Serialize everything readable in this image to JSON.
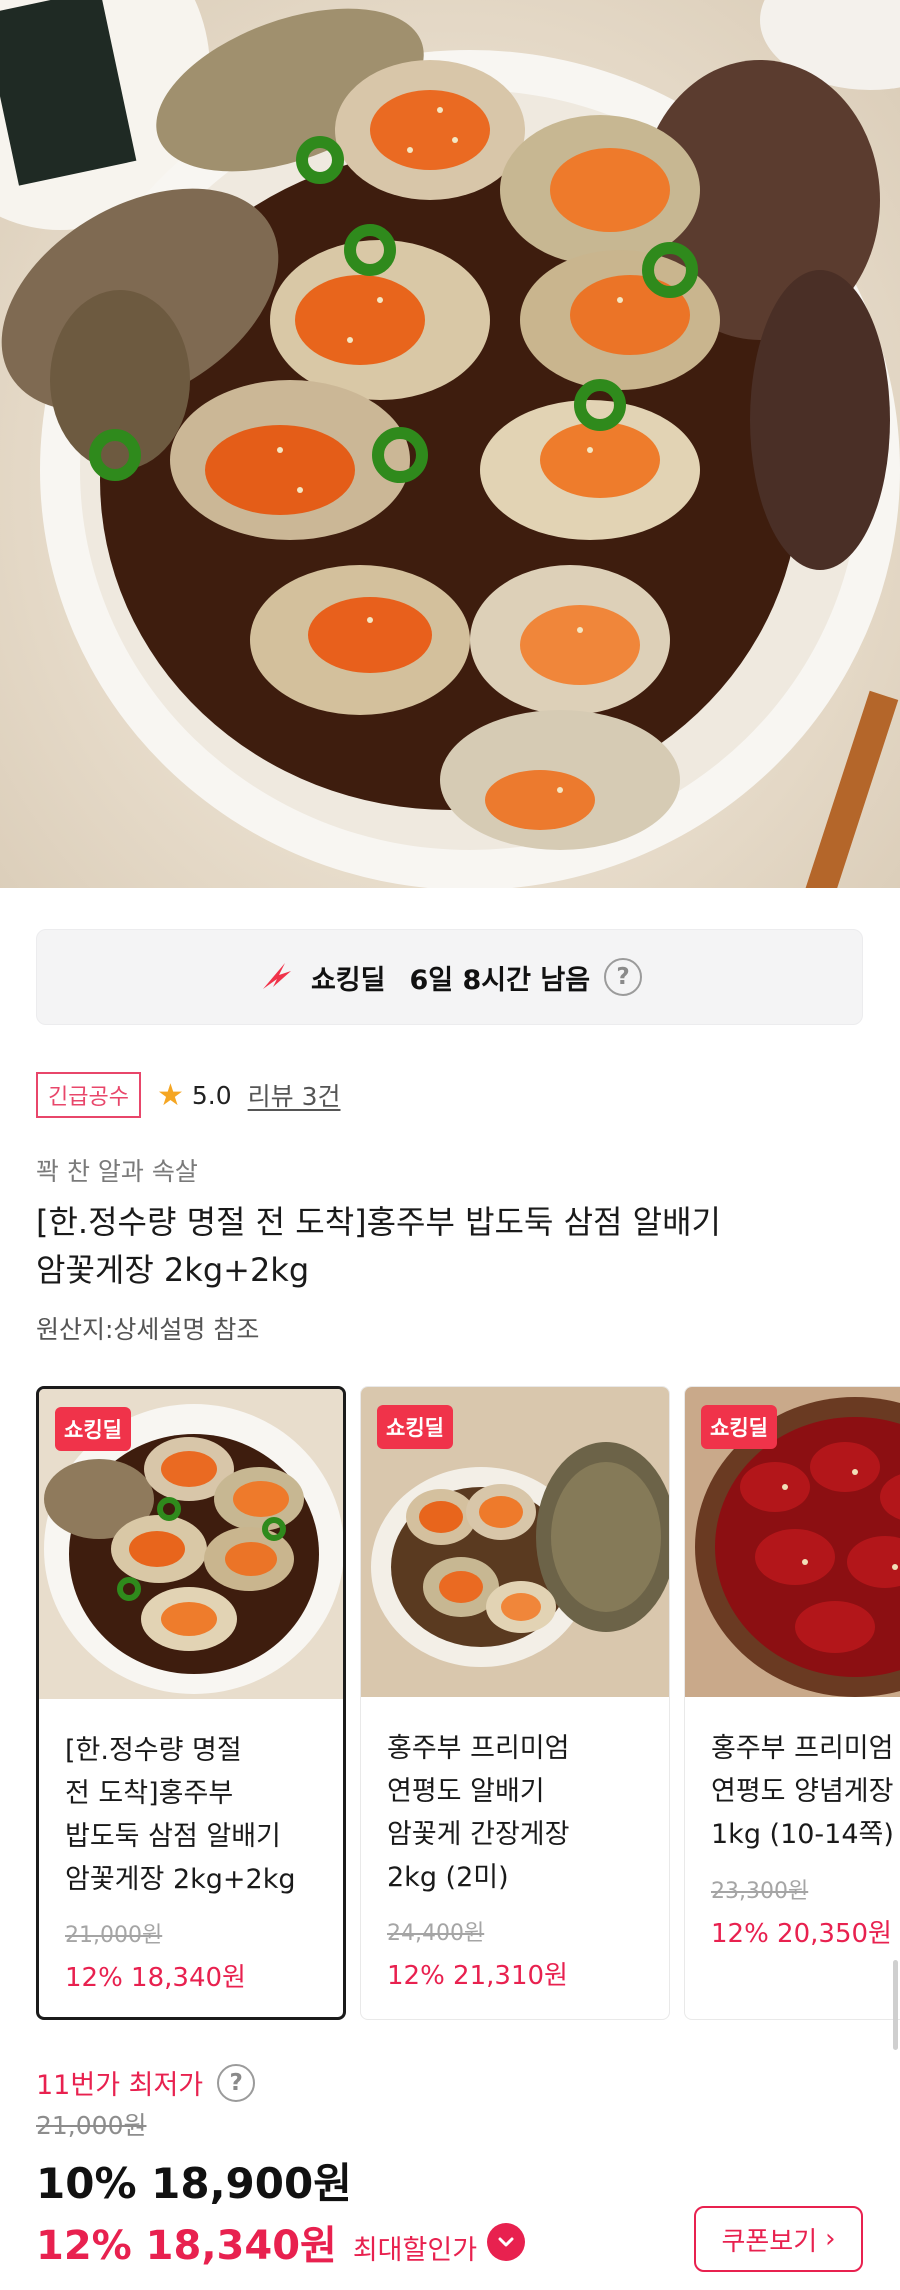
{
  "hero": {
    "image_icon": "marinated-crab-photo"
  },
  "deal_banner": {
    "label": "쇼킹딜",
    "time_left": "6일 8시간 남음",
    "help": "?"
  },
  "badges": {
    "urgent": "긴급공수",
    "rating": "5.0",
    "review": "리뷰 3건"
  },
  "product": {
    "subtitle": "꽉 찬 알과 속살",
    "title_line1": "[한.정수량 명절 전 도착]홍주부 밥도둑 삼점 알배기",
    "title_line2": "암꽃게장 2kg+2kg",
    "origin": "원산지:상세설명 참조"
  },
  "cards": [
    {
      "tag": "쇼킹딜",
      "name": [
        "[한.정수량 명절",
        "전 도착]홍주부",
        "밥도둑 삼점 알배기",
        "암꽃게장 2kg+2kg"
      ],
      "original_price": "21,000원",
      "sale": "12% 18,340원",
      "selected": true
    },
    {
      "tag": "쇼킹딜",
      "name": [
        "홍주부 프리미엄",
        "연평도 알배기",
        "암꽃게 간장게장",
        "2kg (2미)"
      ],
      "original_price": "24,400원",
      "sale": "12% 21,310원",
      "selected": false
    },
    {
      "tag": "쇼킹딜",
      "name": [
        "홍주부 프리미엄",
        "연평도 양념게장",
        "1kg (10-14쪽)"
      ],
      "original_price": "23,300원",
      "sale": "12% 20,350원",
      "selected": false
    }
  ],
  "pricing": {
    "lowest_label": "11번가 최저가",
    "help": "?",
    "original_price": "21,000원",
    "discount_price": "10% 18,900원",
    "max_discount_price": "12% 18,340원",
    "max_discount_label": "최대할인가",
    "coupon_button": "쿠폰보기",
    "coupon_arrow": "›"
  }
}
